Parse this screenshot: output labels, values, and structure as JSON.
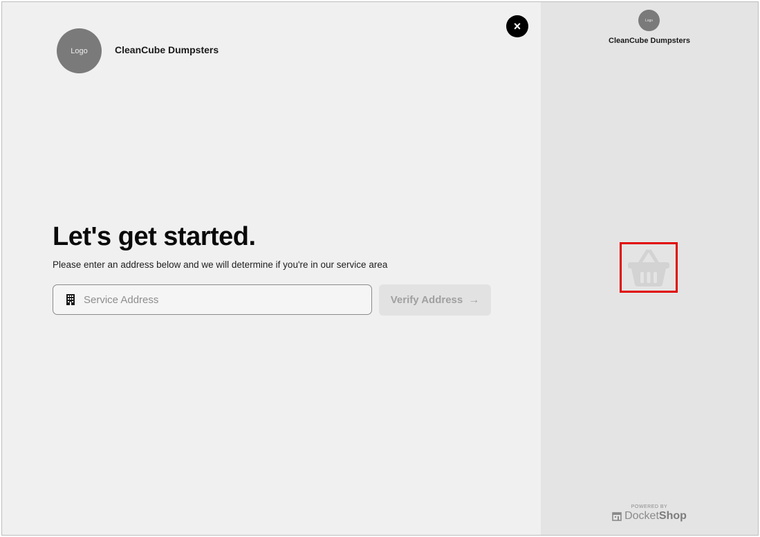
{
  "header": {
    "logo_text": "Logo",
    "brand_name": "CleanCube Dumpsters",
    "close_symbol": "×"
  },
  "main": {
    "title": "Let's get started.",
    "subtitle": "Please enter an address below and we will determine if you're in our service area",
    "address_field": {
      "placeholder": "Service Address",
      "value": "",
      "icon": "building-icon"
    },
    "verify_button": {
      "label": "Verify Address",
      "icon": "arrow-right-icon",
      "arrow_glyph": "→"
    }
  },
  "side_panel": {
    "logo_text": "Logo",
    "brand_name": "CleanCube Dumpsters",
    "cart_icon": "basket-icon",
    "powered_label": "POWERED BY",
    "powered_brand_docket": "Docket",
    "powered_brand_shop": "Shop"
  },
  "colors": {
    "main_bg": "#f0f0f0",
    "side_bg": "#e4e4e4",
    "highlight_border": "#e00000",
    "close_bg": "#000000"
  }
}
